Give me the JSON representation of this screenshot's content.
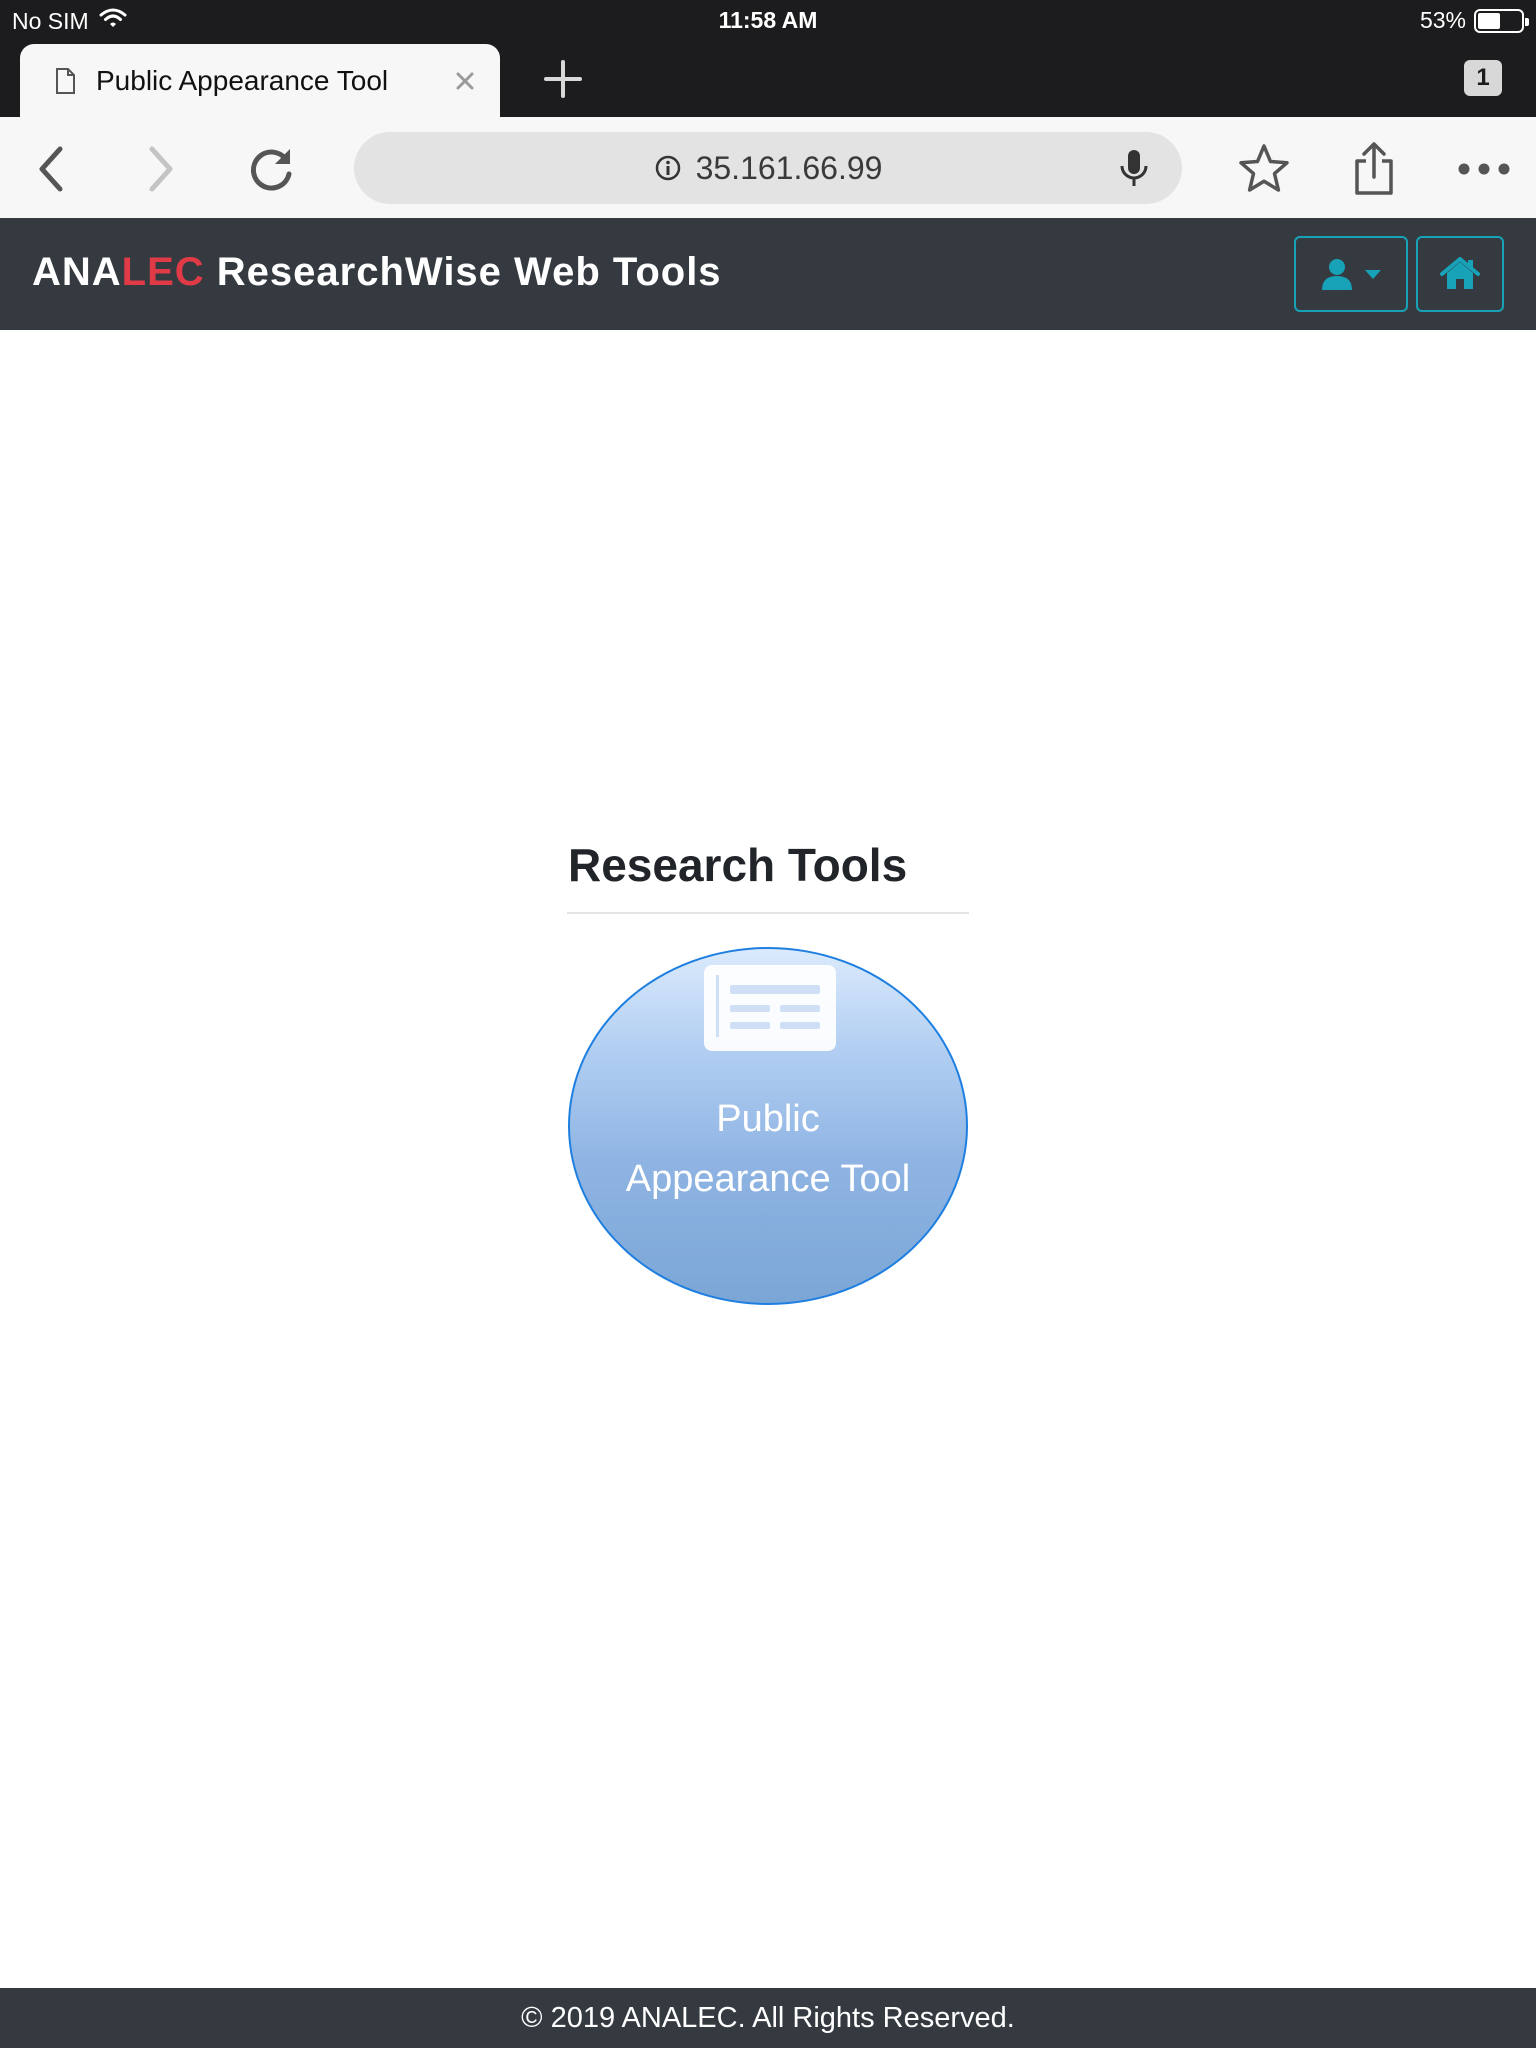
{
  "status_bar": {
    "carrier": "No SIM",
    "time": "11:58 AM",
    "battery": "53%",
    "battery_level": 0.53
  },
  "browser": {
    "tab_title": "Public Appearance Tool",
    "tab_count": "1",
    "url": "35.161.66.99"
  },
  "navbar": {
    "brand_part1": "ANA",
    "brand_part2": "LEC",
    "brand_part3": "ResearchWise Web Tools",
    "brand_accent_color": "#e03a47",
    "button_color": "#17a2b8"
  },
  "main": {
    "section_title": "Research Tools",
    "tools": [
      {
        "label_line1": "Public",
        "label_line2": "Appearance Tool",
        "icon": "newspaper-icon"
      }
    ]
  },
  "footer": {
    "copyright": "© 2019 ANALEC. All Rights Reserved."
  }
}
